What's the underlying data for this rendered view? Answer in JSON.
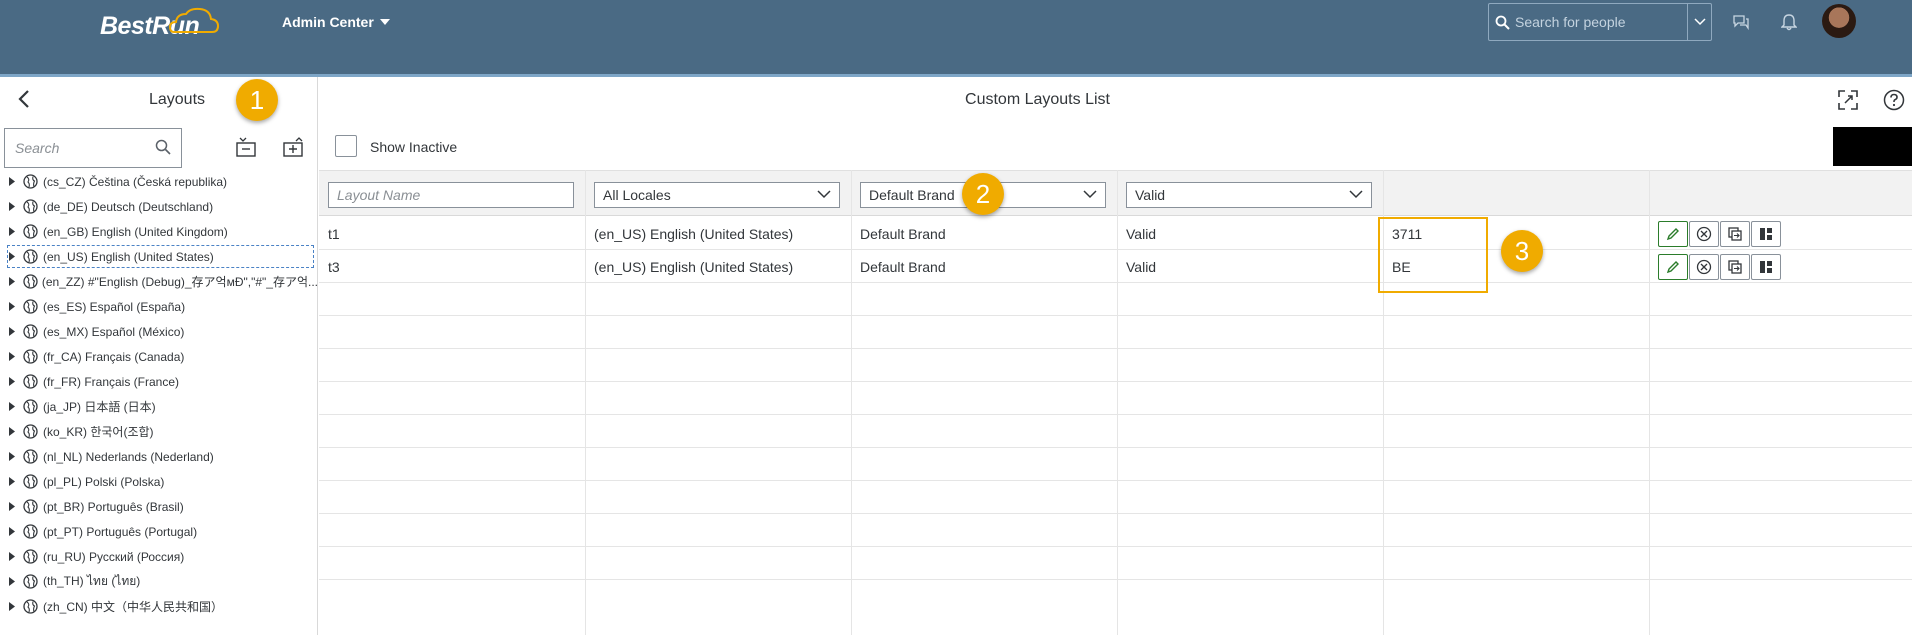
{
  "header": {
    "logo": "BestRun",
    "app_title": "Admin Center",
    "search_placeholder": "Search for people",
    "icons": [
      "search-icon",
      "chevron-down-icon",
      "chat-icon",
      "bell-icon",
      "avatar"
    ],
    "colors": {
      "shell": "#4a6a84",
      "accent_badge": "#f0ab00"
    }
  },
  "left_panel": {
    "title": "Layouts",
    "search_placeholder": "Search",
    "badge": "1",
    "locales": [
      "(cs_CZ) Čeština (Česká republika)",
      "(de_DE) Deutsch (Deutschland)",
      "(en_GB) English (United Kingdom)",
      "(en_US) English (United States)",
      "(en_ZZ) #\"English (Debug)_存ア억мÐ\",\"#\"_存ア억...",
      "(es_ES) Español (España)",
      "(es_MX) Español (México)",
      "(fr_CA) Français (Canada)",
      "(fr_FR) Français (France)",
      "(ja_JP) 日本語 (日本)",
      "(ko_KR) 한국어(조합)",
      "(nl_NL) Nederlands (Nederland)",
      "(pl_PL) Polski (Polska)",
      "(pt_BR) Português (Brasil)",
      "(pt_PT) Português (Portugal)",
      "(ru_RU) Русский (Россия)",
      "(th_TH) ไทย (ไทย)",
      "(zh_CN) 中文（中华人民共和国）"
    ],
    "selected_index": 3
  },
  "main": {
    "title": "Custom Layouts List",
    "show_inactive_label": "Show Inactive",
    "filters": {
      "layout_name_placeholder": "Layout Name",
      "locale": "All Locales",
      "brand": "Default Brand",
      "status": "Valid"
    },
    "badges": [
      "2",
      "3"
    ],
    "rows": [
      {
        "name": "t1",
        "locale": "(en_US) English (United States)",
        "brand": "Default Brand",
        "status": "Valid",
        "code": "3711"
      },
      {
        "name": "t3",
        "locale": "(en_US) English (United States)",
        "brand": "Default Brand",
        "status": "Valid",
        "code": "BE"
      }
    ]
  }
}
